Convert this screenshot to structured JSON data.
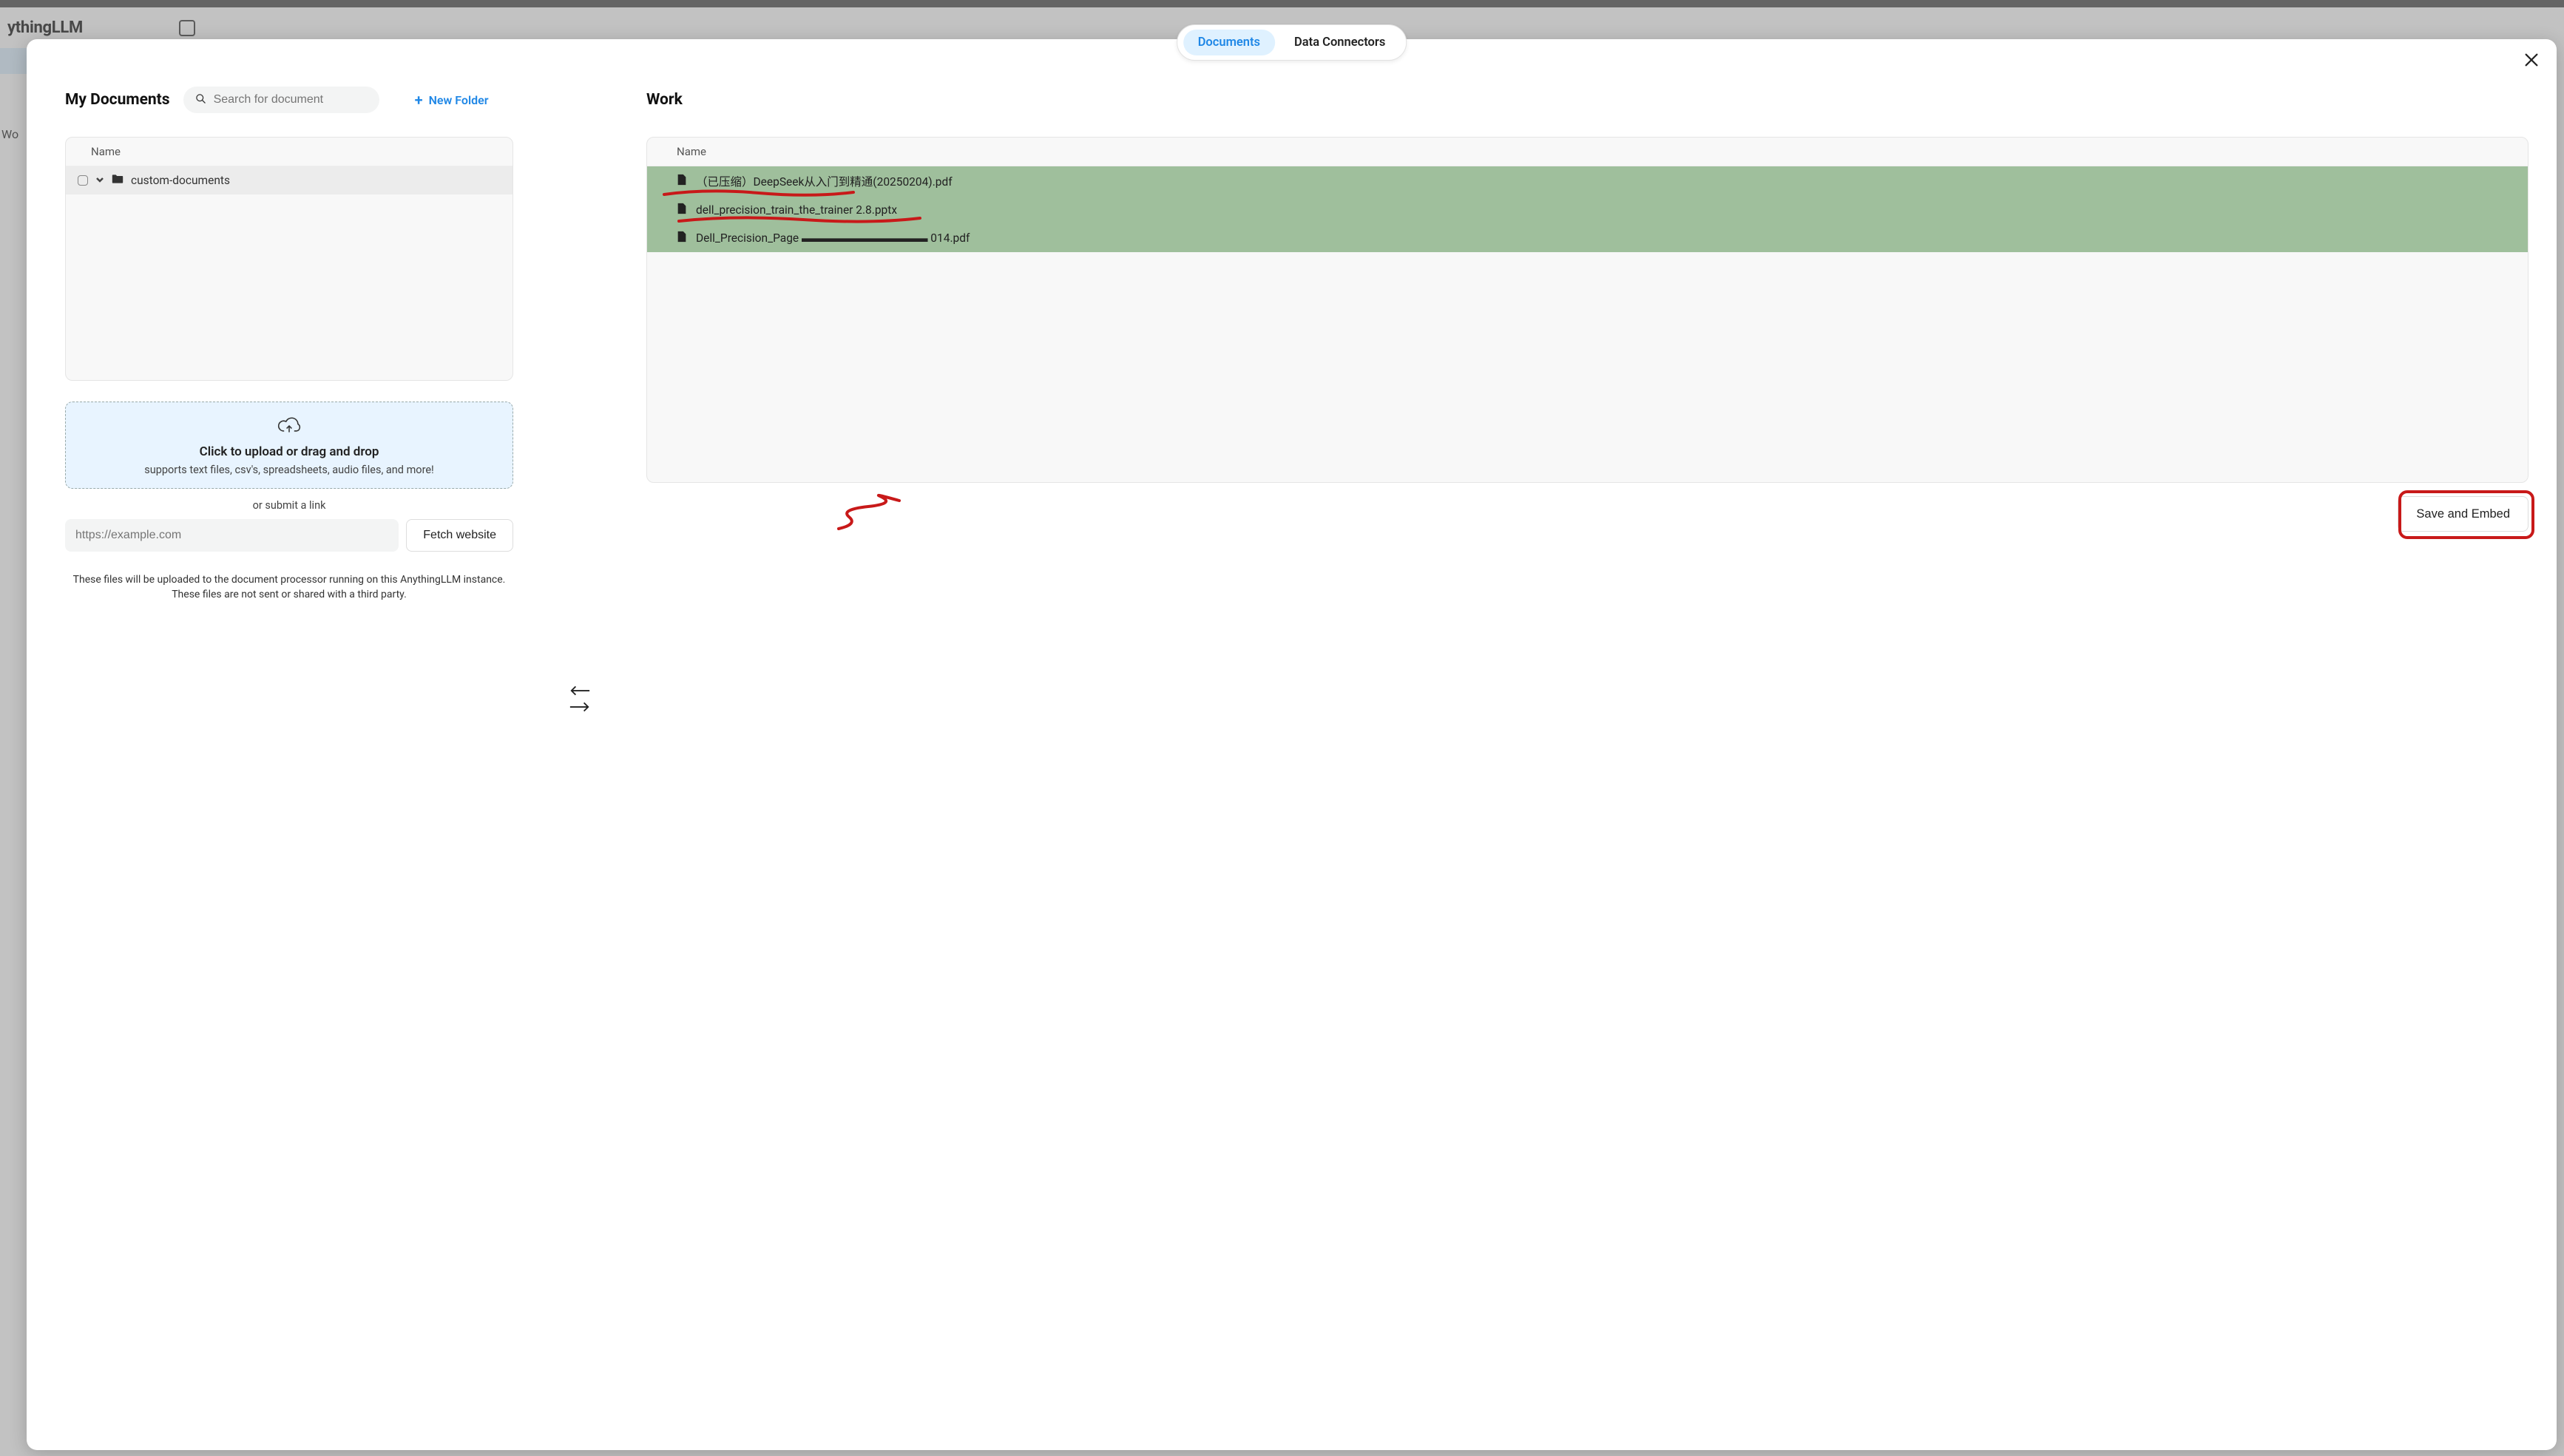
{
  "app": {
    "brand": "ythingLLM",
    "sidebar_label": "Wo"
  },
  "tabs": {
    "documents": "Documents",
    "connectors": "Data Connectors"
  },
  "left": {
    "title": "My Documents",
    "search_placeholder": "Search for document",
    "new_folder": "New Folder",
    "name_header": "Name",
    "folders": [
      {
        "name": "custom-documents"
      }
    ],
    "upload_title": "Click to upload or drag and drop",
    "upload_sub": "supports text files, csv's, spreadsheets, audio files, and more!",
    "or_submit": "or submit a link",
    "link_placeholder": "https://example.com",
    "fetch_btn": "Fetch website",
    "disclaimer_l1": "These files will be uploaded to the document processor running on this AnythingLLM instance.",
    "disclaimer_l2": "These files are not sent or shared with a third party."
  },
  "right": {
    "title": "Work",
    "name_header": "Name",
    "files": [
      {
        "name": "（已压缩）DeepSeek从入门到精通(20250204).pdf"
      },
      {
        "name": "dell_precision_train_the_trainer 2.8.pptx"
      },
      {
        "name": "Dell_Precision_Page ▬▬▬▬▬▬▬▬▬▬▬ 014.pdf"
      }
    ],
    "save_btn": "Save and Embed"
  }
}
